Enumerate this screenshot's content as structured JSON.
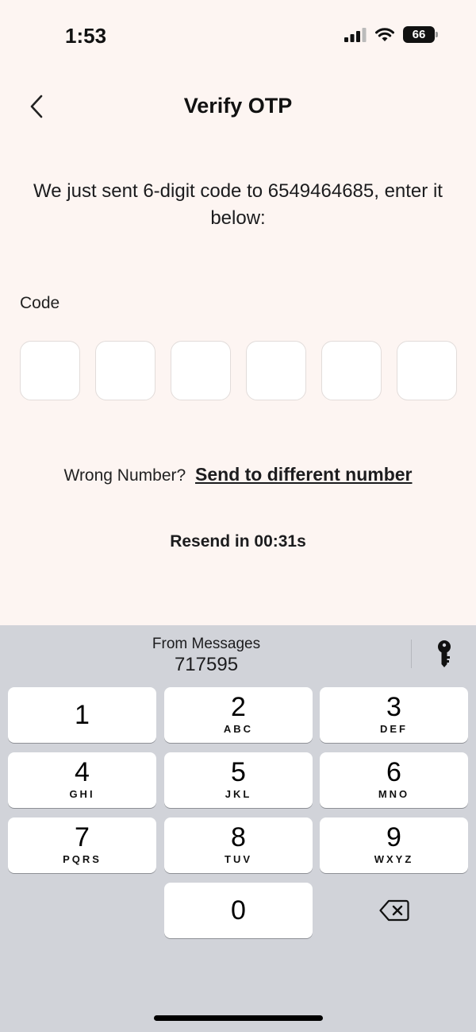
{
  "status_bar": {
    "time": "1:53",
    "battery": "66"
  },
  "header": {
    "title": "Verify OTP"
  },
  "instruction": {
    "text": "We just sent 6-digit code to 6549464685, enter it below:"
  },
  "code": {
    "label": "Code",
    "digits": [
      "",
      "",
      "",
      "",
      "",
      ""
    ]
  },
  "wrong_number": {
    "prompt": "Wrong Number?",
    "link": "Send to different number"
  },
  "resend": {
    "text": "Resend in 00:31s"
  },
  "keyboard": {
    "suggestion": {
      "title": "From Messages",
      "code": "717595"
    },
    "keys": [
      {
        "digit": "1",
        "letters": ""
      },
      {
        "digit": "2",
        "letters": "ABC"
      },
      {
        "digit": "3",
        "letters": "DEF"
      },
      {
        "digit": "4",
        "letters": "GHI"
      },
      {
        "digit": "5",
        "letters": "JKL"
      },
      {
        "digit": "6",
        "letters": "MNO"
      },
      {
        "digit": "7",
        "letters": "PQRS"
      },
      {
        "digit": "8",
        "letters": "TUV"
      },
      {
        "digit": "9",
        "letters": "WXYZ"
      },
      {
        "digit": "0",
        "letters": ""
      }
    ]
  },
  "icons": {
    "back": "chevron-left-icon",
    "signal": "signal-icon",
    "wifi": "wifi-icon",
    "battery": "battery-icon",
    "passwords": "key-icon",
    "delete": "backspace-icon"
  },
  "colors": {
    "background": "#fdf5f2",
    "keyboard": "#d1d3d9",
    "key": "#ffffff"
  }
}
